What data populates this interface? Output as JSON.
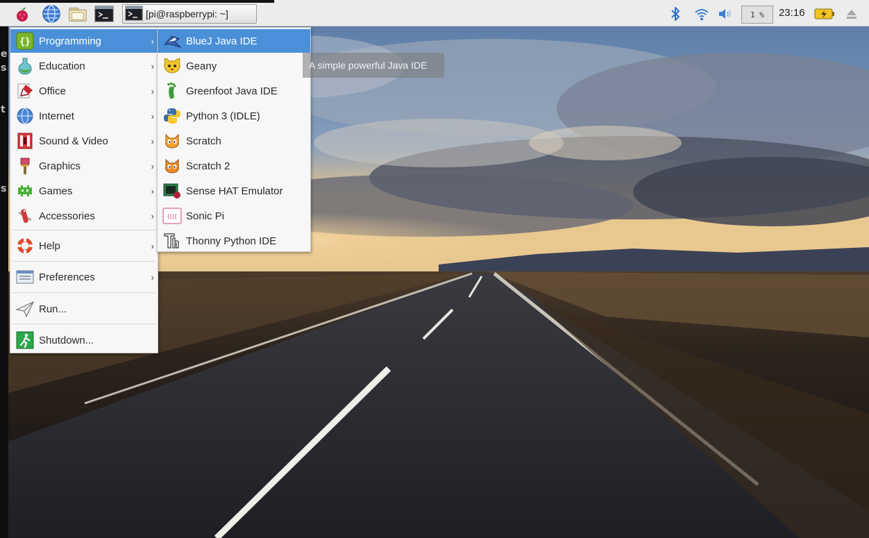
{
  "panel": {
    "task_label": "[pi@raspberrypi: ~]",
    "cpu_label": "1 %",
    "clock": "23:16",
    "icons": [
      "raspberry-menu-icon",
      "web-browser-icon",
      "file-manager-icon",
      "terminal-icon"
    ],
    "tray_icons": [
      "bluetooth-icon",
      "wifi-icon",
      "volume-icon",
      "battery-icon",
      "eject-icon"
    ]
  },
  "main_menu": {
    "items": [
      {
        "label": "Programming",
        "icon": "programming-icon",
        "has_submenu": true,
        "selected": true
      },
      {
        "label": "Education",
        "icon": "education-icon",
        "has_submenu": true
      },
      {
        "label": "Office",
        "icon": "office-icon",
        "has_submenu": true
      },
      {
        "label": "Internet",
        "icon": "internet-icon",
        "has_submenu": true
      },
      {
        "label": "Sound & Video",
        "icon": "sound-video-icon",
        "has_submenu": true
      },
      {
        "label": "Graphics",
        "icon": "graphics-icon",
        "has_submenu": true
      },
      {
        "label": "Games",
        "icon": "games-icon",
        "has_submenu": true
      },
      {
        "label": "Accessories",
        "icon": "accessories-icon",
        "has_submenu": true
      },
      {
        "label": "Help",
        "icon": "help-icon",
        "has_submenu": true
      },
      {
        "label": "Preferences",
        "icon": "preferences-icon",
        "has_submenu": true
      },
      {
        "label": "Run...",
        "icon": "run-icon",
        "has_submenu": false
      },
      {
        "label": "Shutdown...",
        "icon": "shutdown-icon",
        "has_submenu": false
      }
    ]
  },
  "sub_menu": {
    "items": [
      {
        "label": "BlueJ Java IDE",
        "icon": "bluej-icon",
        "selected": true
      },
      {
        "label": "Geany",
        "icon": "geany-icon"
      },
      {
        "label": "Greenfoot Java IDE",
        "icon": "greenfoot-icon"
      },
      {
        "label": "Python 3 (IDLE)",
        "icon": "python-icon"
      },
      {
        "label": "Scratch",
        "icon": "scratch-icon"
      },
      {
        "label": "Scratch 2",
        "icon": "scratch2-icon"
      },
      {
        "label": "Sense HAT Emulator",
        "icon": "sense-hat-icon"
      },
      {
        "label": "Sonic Pi",
        "icon": "sonic-pi-icon"
      },
      {
        "label": "Thonny Python IDE",
        "icon": "thonny-icon"
      }
    ]
  },
  "tooltip": "A simple powerful Java IDE",
  "colors": {
    "selection": "#4a90d9",
    "panel": "#ececec",
    "menu_bg": "#f7f7f7"
  }
}
